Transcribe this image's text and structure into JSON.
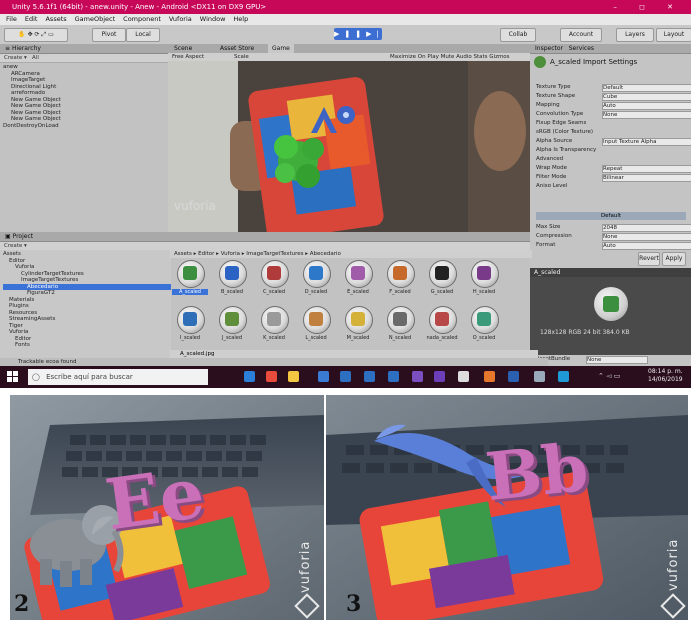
{
  "window": {
    "title": "Unity 5.6.1f1 (64bit) - anew.unity - Anew - Android <DX11 on DX9 GPU>",
    "controls": "–  ◻  ✕"
  },
  "menu": [
    "File",
    "Edit",
    "Assets",
    "GameObject",
    "Component",
    "Vuforia",
    "Window",
    "Help"
  ],
  "toolbar": {
    "pivot": "Pivot",
    "local": "Local",
    "collab": "Collab",
    "account": "Account",
    "layers": "Layers",
    "layout": "Layout"
  },
  "hierarchy": {
    "tab": "Hierarchy",
    "create": "Create",
    "search": "All",
    "items": [
      "anew",
      "ARCamera",
      "ImageTarget",
      "Directional Light",
      "arreformado",
      "New Game Object",
      "New Game Object",
      "New Game Object",
      "New Game Object",
      "DontDestroyOnLoad"
    ]
  },
  "game": {
    "tabs": [
      "Scene",
      "Asset Store",
      "Game"
    ],
    "aspect": "Free Aspect",
    "scale": "Scale",
    "options": "Maximize On Play  Mute Audio  Stats  Gizmos",
    "watermark": "vuforia"
  },
  "inspector": {
    "tabs": [
      "Inspector",
      "Services"
    ],
    "title": "A_scaled Import Settings",
    "rows": [
      {
        "label": "Texture Type",
        "value": "Default"
      },
      {
        "label": "Texture Shape",
        "value": "Cube"
      },
      {
        "label": "Mapping",
        "value": "Auto"
      },
      {
        "label": "Convolution Type",
        "value": "None"
      },
      {
        "label": "Fixup Edge Seams",
        "value": ""
      },
      {
        "label": "sRGB (Color Texture)",
        "value": ""
      },
      {
        "label": "Alpha Source",
        "value": "Input Texture Alpha"
      },
      {
        "label": "Alpha Is Transparency",
        "value": ""
      },
      {
        "label": "Advanced",
        "value": ""
      },
      {
        "label": "Wrap Mode",
        "value": "Repeat"
      },
      {
        "label": "Filter Mode",
        "value": "Bilinear"
      },
      {
        "label": "Aniso Level",
        "value": ""
      }
    ],
    "platform": "Default",
    "max_size_label": "Max Size",
    "max_size": "2048",
    "compression_label": "Compression",
    "compression": "None",
    "format_label": "Format",
    "format": "Auto",
    "revert": "Revert",
    "apply": "Apply",
    "preview_name": "A_scaled",
    "preview_info": "128x128 RGB 24 bit  384.0 KB",
    "assetbundle_label": "AssetBundle",
    "assetbundle_value": "None"
  },
  "project": {
    "tab": "Project",
    "create": "Create",
    "breadcrumb": "Assets ▸ Editor ▸ Vuforia ▸ ImageTargetTextures ▸ Abecedario",
    "tree": [
      "Assets",
      "Editor",
      "Vuforia",
      "CylinderTargetTextures",
      "ImageTargetTextures",
      "Abecedario",
      "FiguraGT2",
      "Materials",
      "Plugins",
      "Resources",
      "StreamingAssets",
      "Tiger",
      "Vuforia",
      "Editor",
      "Fonts"
    ],
    "tiles": [
      {
        "name": "A_scaled",
        "icon": "#3b8f3f"
      },
      {
        "name": "B_scaled",
        "icon": "#2b63c4"
      },
      {
        "name": "C_scaled",
        "icon": "#b03b3b"
      },
      {
        "name": "D_scaled",
        "icon": "#2d78c8"
      },
      {
        "name": "E_scaled",
        "icon": "#a05ca8"
      },
      {
        "name": "F_scaled",
        "icon": "#c56a2a"
      },
      {
        "name": "G_scaled",
        "icon": "#222222"
      },
      {
        "name": "H_scaled",
        "icon": "#7a3a8a"
      },
      {
        "name": "I_scaled",
        "icon": "#2f6fb8"
      },
      {
        "name": "J_scaled",
        "icon": "#5f8f3a"
      },
      {
        "name": "K_scaled",
        "icon": "#9a9a9a"
      },
      {
        "name": "L_scaled",
        "icon": "#c08040"
      },
      {
        "name": "M_scaled",
        "icon": "#d4b23a"
      },
      {
        "name": "N_scaled",
        "icon": "#6a6a6a"
      },
      {
        "name": "nada_scaled",
        "icon": "#b84848"
      },
      {
        "name": "O_scaled",
        "icon": "#3a9a7a"
      }
    ],
    "selected_file": "A_scaled.jpg"
  },
  "status": "Trackable ecoa found",
  "taskbar": {
    "search": "Escribe aquí para buscar",
    "time": "08:14 p. m.",
    "date": "14/06/2019"
  },
  "photos": [
    {
      "number": "2",
      "letters": "Ee",
      "watermark": "vuforia"
    },
    {
      "number": "3",
      "letters": "Bb",
      "watermark": "vuforia"
    }
  ],
  "colors": {
    "title_bar": "#c70859",
    "taskbar": "#2a0e1e",
    "selection": "#3a72d8",
    "letters_pink": "#c970b8"
  }
}
